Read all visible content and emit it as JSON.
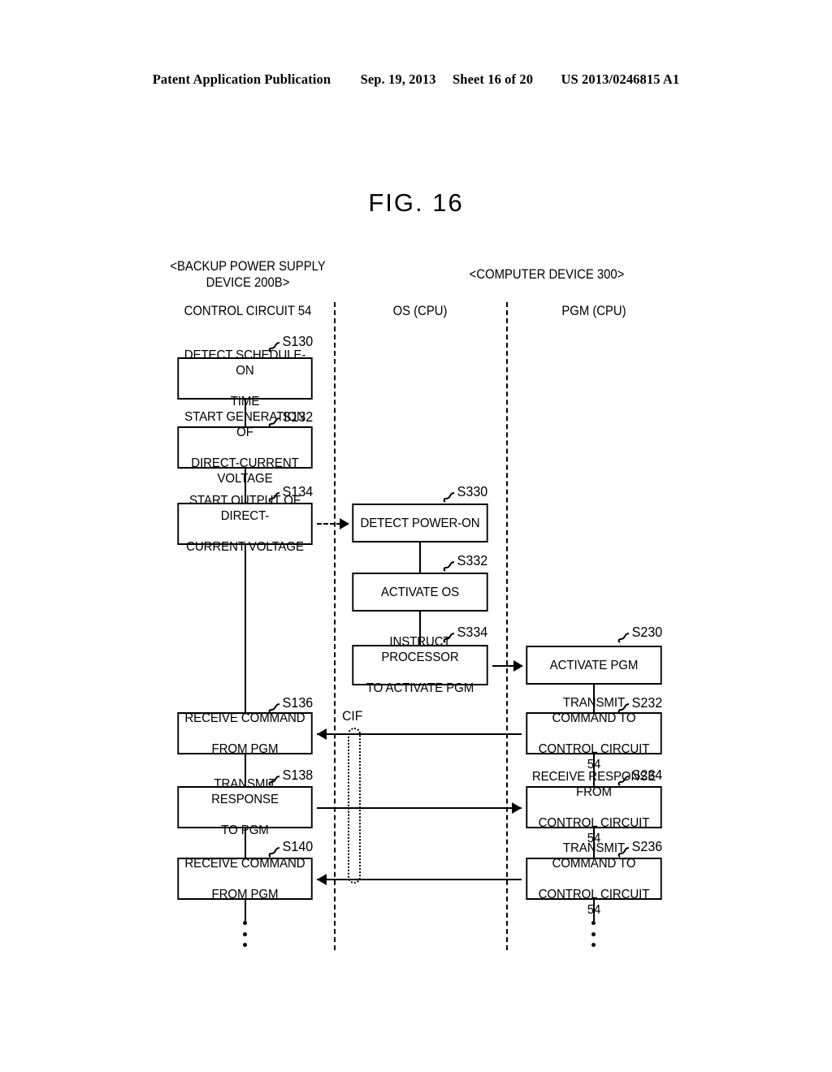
{
  "header": {
    "publication": "Patent Application Publication",
    "date": "Sep. 19, 2013",
    "sheet": "Sheet 16 of 20",
    "patent_number": "US 2013/0246815 A1"
  },
  "figure": {
    "title": "FIG. 16"
  },
  "lanes": {
    "left": {
      "group_title": "<BACKUP POWER SUPPLY\nDEVICE 200B>",
      "group_title_line1": "<BACKUP POWER SUPPLY",
      "group_title_line2": "DEVICE 200B>",
      "actor": "CONTROL CIRCUIT 54"
    },
    "middle": {
      "group_title": "<COMPUTER DEVICE 300>",
      "actor": "OS (CPU)"
    },
    "right": {
      "actor": "PGM (CPU)"
    }
  },
  "interface_label": "CIF",
  "steps": {
    "s130": {
      "id": "S130",
      "line1": "DETECT SCHEDULE-ON",
      "line2": "TIME"
    },
    "s132": {
      "id": "S132",
      "line1": "START GENERATION OF",
      "line2": "DIRECT-CURRENT VOLTAGE"
    },
    "s134": {
      "id": "S134",
      "line1": "START OUTPUT OF DIRECT-",
      "line2": "CURRENT VOLTAGE"
    },
    "s136": {
      "id": "S136",
      "line1": "RECEIVE COMMAND",
      "line2": "FROM PGM"
    },
    "s138": {
      "id": "S138",
      "line1": "TRANSMIT RESPONSE",
      "line2": "TO PGM"
    },
    "s140": {
      "id": "S140",
      "line1": "RECEIVE COMMAND",
      "line2": "FROM PGM"
    },
    "s330": {
      "id": "S330",
      "line1": "DETECT POWER-ON",
      "line2": ""
    },
    "s332": {
      "id": "S332",
      "line1": "ACTIVATE OS",
      "line2": ""
    },
    "s334": {
      "id": "S334",
      "line1": "INSTRUCT PROCESSOR",
      "line2": "TO ACTIVATE PGM"
    },
    "s230": {
      "id": "S230",
      "line1": "ACTIVATE PGM",
      "line2": ""
    },
    "s232": {
      "id": "S232",
      "line1": "TRANSMIT COMMAND TO",
      "line2": "CONTROL CIRCUIT 54"
    },
    "s234": {
      "id": "S234",
      "line1": "RECEIVE RESPONSE FROM",
      "line2": "CONTROL CIRCUIT 54"
    },
    "s236": {
      "id": "S236",
      "line1": "TRANSMIT COMMAND TO",
      "line2": "CONTROL CIRCUIT 54"
    }
  },
  "colors": {
    "ink": "#000000",
    "page": "#ffffff"
  }
}
